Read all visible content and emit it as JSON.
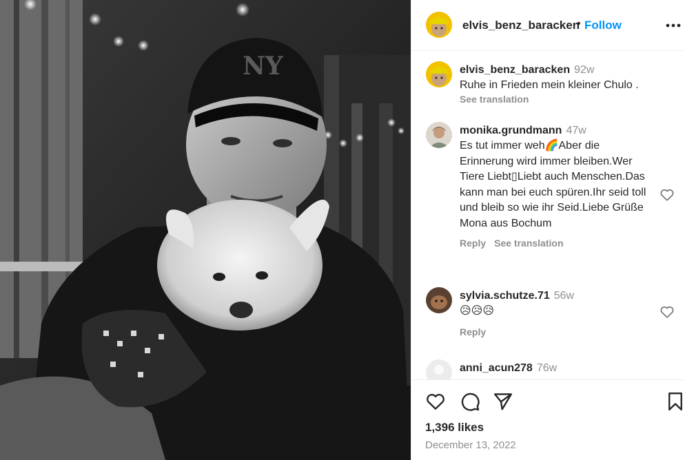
{
  "post": {
    "author": "elvis_benz_baracken",
    "dot": "•",
    "follow_label": "Follow",
    "likes": "1,396 likes",
    "date": "December 13, 2022"
  },
  "comments": [
    {
      "user": "elvis_benz_baracken",
      "time": "92w",
      "text": "Ruhe in Frieden mein kleiner Chulo .",
      "actions": [
        "See translation"
      ]
    },
    {
      "user": "monika.grundmann",
      "time": "47w",
      "text": "Es tut immer weh🌈Aber die Erinnerung wird immer bleiben.Wer Tiere Liebt▯Liebt auch Menschen.Das kann man bei euch spüren.Ihr seid toll und bleib so wie ihr Seid.Liebe Grüße Mona aus Bochum",
      "actions": [
        "Reply",
        "See translation"
      ]
    },
    {
      "user": "sylvia.schutze.71",
      "time": "56w",
      "text": "😥😥😥",
      "actions": [
        "Reply"
      ]
    },
    {
      "user": "anni_acun278",
      "time": "76w",
      "text": "",
      "actions": []
    }
  ],
  "icons": {
    "more": "more-options-icon",
    "like": "heart-icon",
    "comment": "comment-icon",
    "share": "share-icon",
    "save": "bookmark-icon"
  },
  "colors": {
    "accent": "#0095f6",
    "text": "#262626",
    "muted": "#8e8e8e",
    "divider": "#efefef"
  }
}
